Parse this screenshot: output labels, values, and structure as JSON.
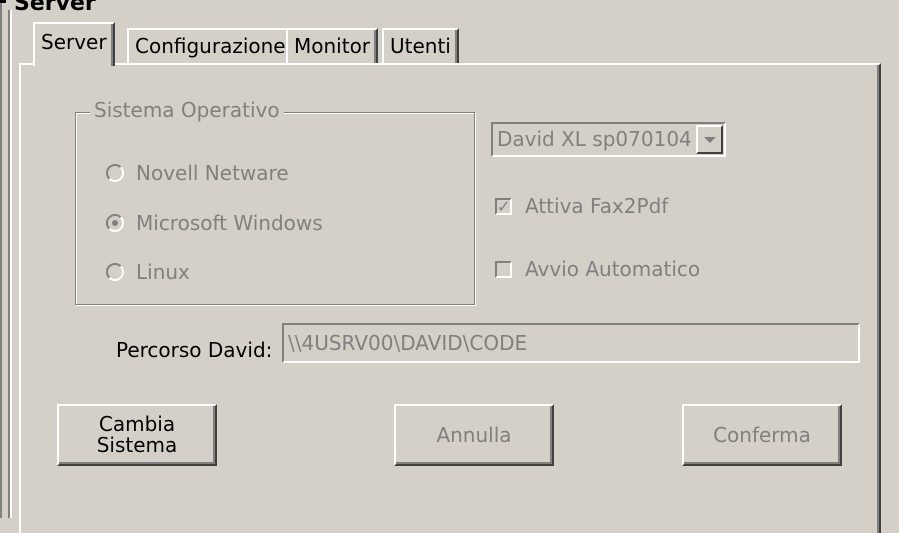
{
  "window": {
    "title": "Server"
  },
  "tabs": [
    {
      "label": "Server"
    },
    {
      "label": "Configurazione"
    },
    {
      "label": "Monitor"
    },
    {
      "label": "Utenti"
    }
  ],
  "os_group": {
    "legend": "Sistema Operativo",
    "options": [
      {
        "label": "Novell Netware",
        "selected": false
      },
      {
        "label": "Microsoft Windows",
        "selected": true
      },
      {
        "label": "Linux",
        "selected": false
      }
    ]
  },
  "version_select": {
    "value": "David XL sp070104"
  },
  "options": {
    "fax2pdf": {
      "label": "Attiva Fax2Pdf",
      "checked": true
    },
    "autostart": {
      "label": "Avvio Automatico",
      "checked": false
    }
  },
  "path": {
    "label": "Percorso David:",
    "value": "\\\\4USRV00\\DAVID\\CODE"
  },
  "buttons": {
    "change_system": "Cambia\nSistema",
    "cancel": "Annulla",
    "confirm": "Conferma"
  },
  "icons": {
    "dropdown": "chevron-down-icon",
    "check": "check-icon"
  },
  "colors": {
    "face": "#d4d0c8",
    "disabled_text": "#808080",
    "highlight": "#ffffff",
    "shadow": "#808080"
  }
}
